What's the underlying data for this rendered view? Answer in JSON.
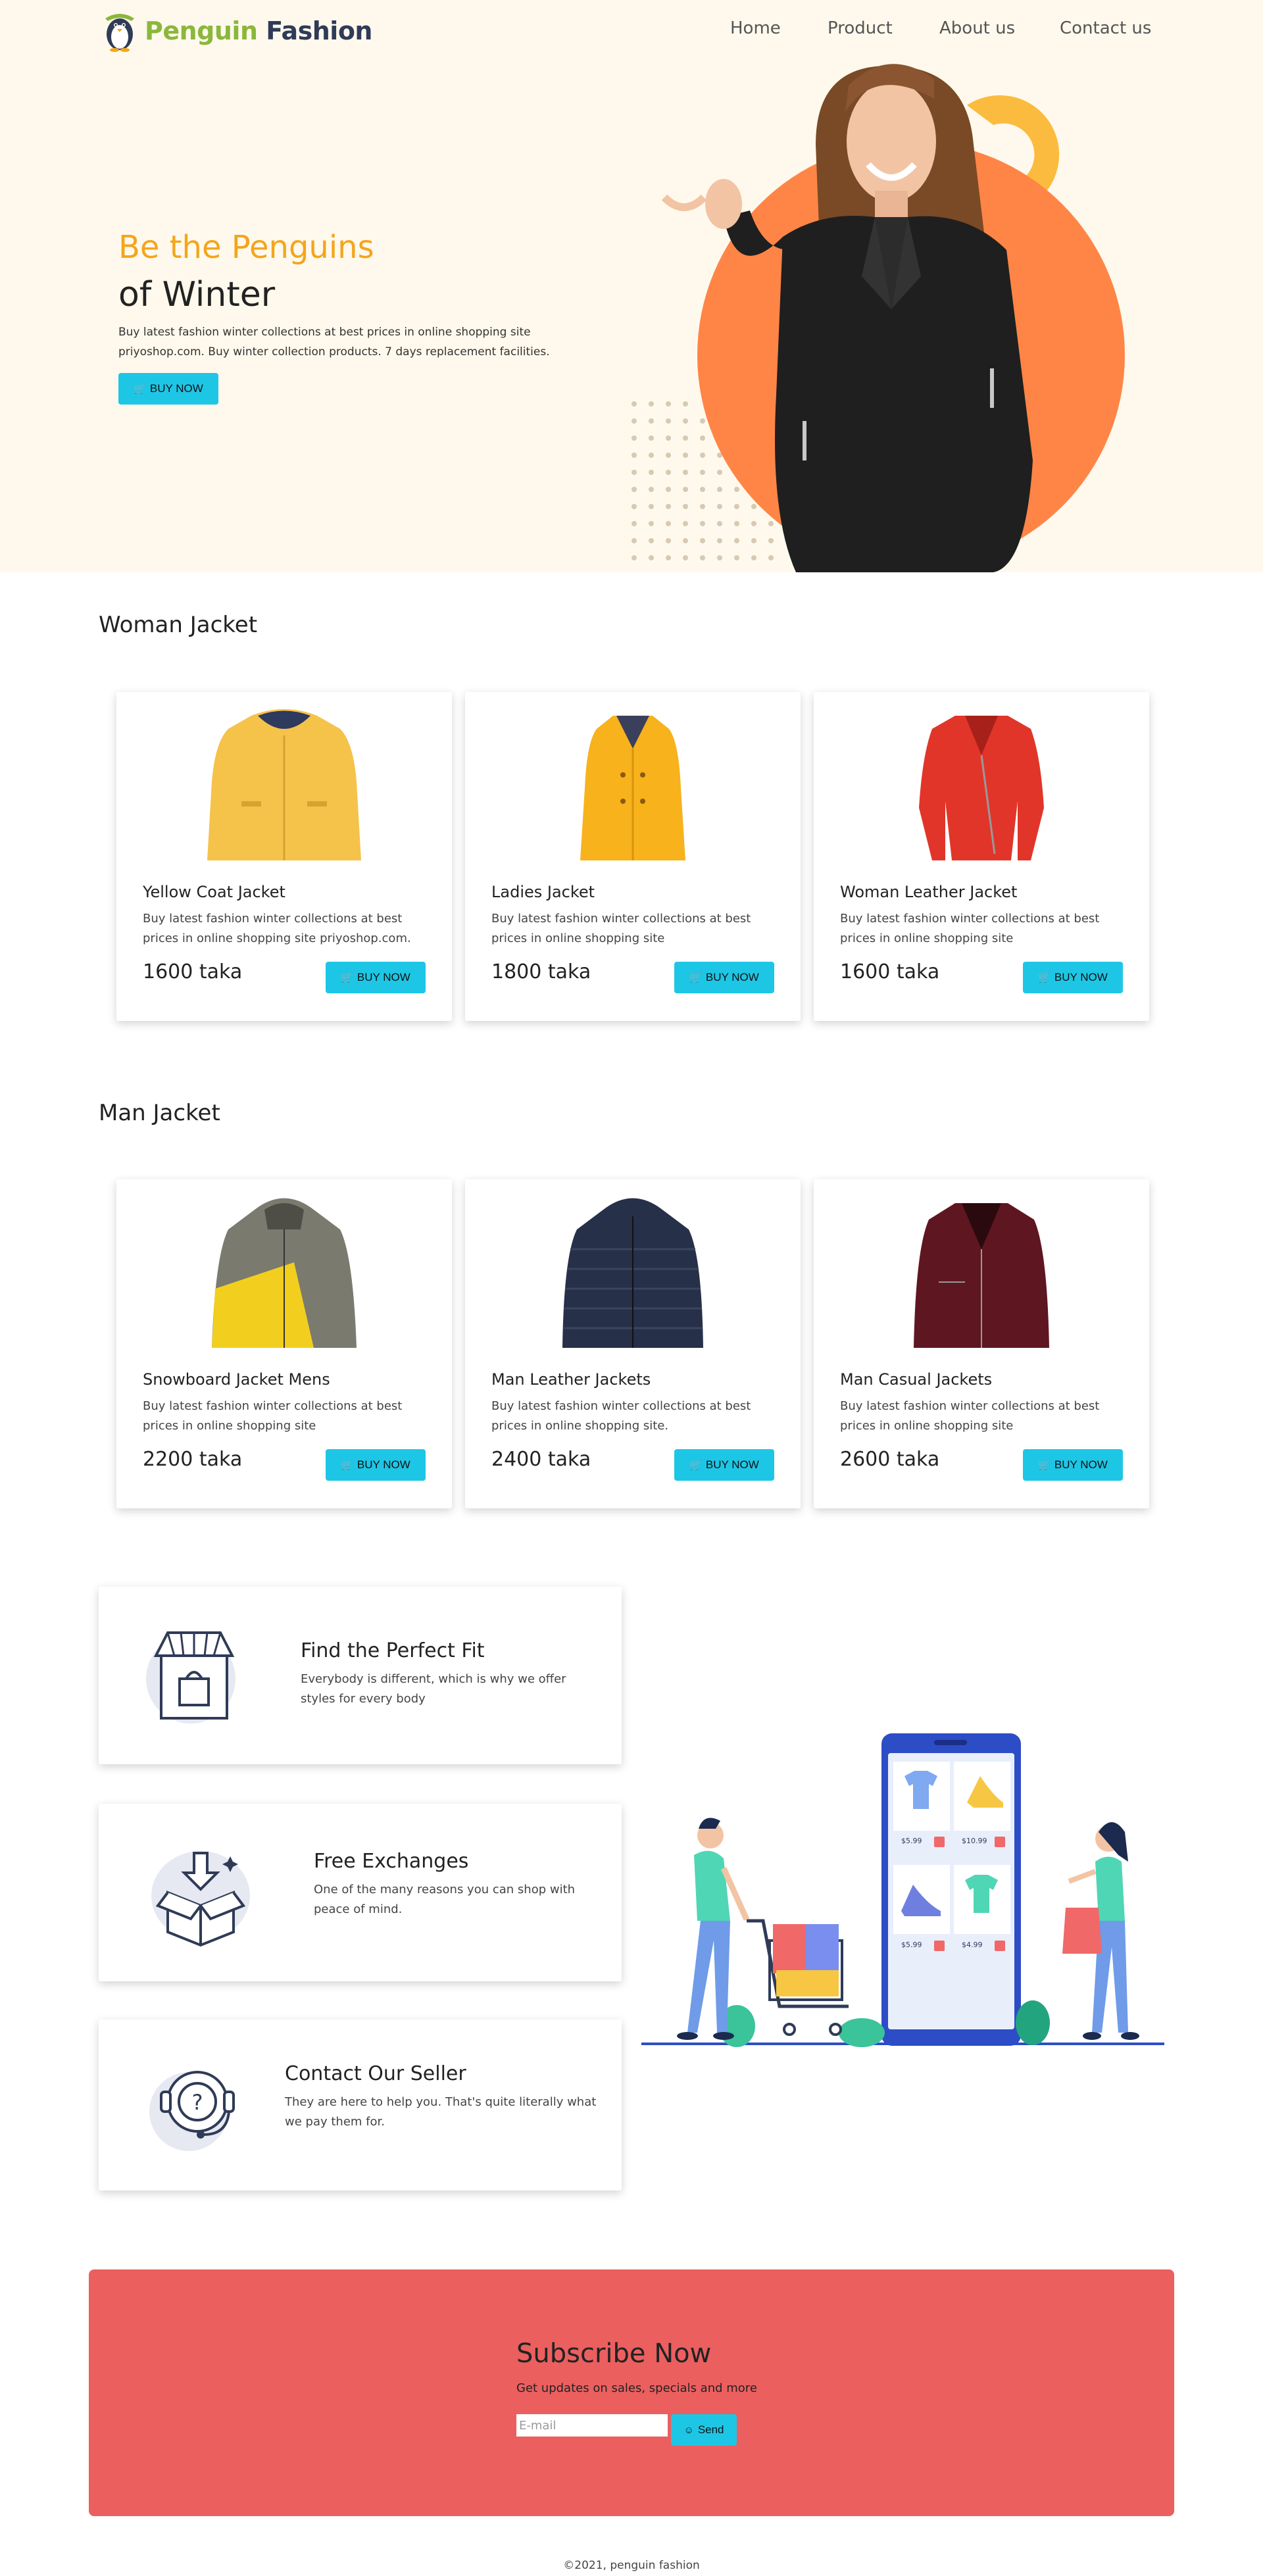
{
  "brand": {
    "name_part_1": "Penguin",
    "name_part_2": "Fashion"
  },
  "nav": {
    "links": [
      "Home",
      "Product",
      "About us",
      "Contact us"
    ]
  },
  "hero": {
    "title_line_1": "Be the Penguins",
    "title_line_2": "of Winter",
    "description": "Buy latest fashion winter collections at best prices in online shopping site priyoshop.com. Buy winter collection products. 7 days replacement facilities.",
    "button_label": "BUY NOW"
  },
  "woman_section": {
    "title": "Woman Jacket",
    "products": [
      {
        "name": "Yellow Coat Jacket",
        "description": "Buy latest fashion winter collections at best prices in online shopping site priyoshop.com.",
        "price": "1600 taka",
        "button_label": "BUY NOW",
        "image": "yellow-coat-jacket"
      },
      {
        "name": "Ladies Jacket",
        "description": "Buy latest fashion winter collections at best prices in online shopping site",
        "price": "1800 taka",
        "button_label": "BUY NOW",
        "image": "ladies-jacket"
      },
      {
        "name": "Woman Leather Jacket",
        "description": "Buy latest fashion winter collections at best prices in online shopping site",
        "price": "1600 taka",
        "button_label": "BUY NOW",
        "image": "red-leather-jacket"
      }
    ]
  },
  "man_section": {
    "title": "Man Jacket",
    "products": [
      {
        "name": "Snowboard Jacket Mens",
        "description": "Buy latest fashion winter collections at best prices in online shopping site",
        "price": "2200 taka",
        "button_label": "BUY NOW",
        "image": "snowboard-jacket"
      },
      {
        "name": "Man Leather Jackets",
        "description": "Buy latest fashion winter collections at best prices in online shopping site.",
        "price": "2400 taka",
        "button_label": "BUY NOW",
        "image": "navy-puffer-jacket"
      },
      {
        "name": "Man Casual Jackets",
        "description": "Buy latest fashion winter collections at best prices in online shopping site",
        "price": "2600 taka",
        "button_label": "BUY NOW",
        "image": "maroon-leather-jacket"
      }
    ]
  },
  "features": [
    {
      "title": "Find the Perfect Fit",
      "description": "Everybody is different, which is why we offer styles for every body",
      "icon": "store-icon"
    },
    {
      "title": "Free Exchanges",
      "description": "One of the many reasons you can shop with peace of mind.",
      "icon": "box-icon"
    },
    {
      "title": "Contact Our Seller",
      "description": "They are here to help you. That's quite literally what we pay them for.",
      "icon": "support-icon"
    }
  ],
  "shop_illustration": {
    "prices": [
      "$5.99",
      "$10.99",
      "$5.99",
      "$4.99"
    ]
  },
  "subscribe": {
    "title": "Subscribe Now",
    "description": "Get updates on sales, specials and more",
    "email_placeholder": "E-mail",
    "button_label": "Send"
  },
  "footer": {
    "text": "©2021, penguin fashion"
  },
  "colors": {
    "accent_yellow": "#f4a51c",
    "button_cyan": "#1ec6e6",
    "hero_bg": "#fef9ec",
    "subscribe_bg": "#eb5f5f",
    "circle_orange": "#ff8547"
  }
}
